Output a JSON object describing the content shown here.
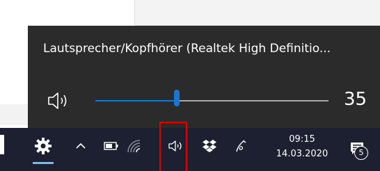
{
  "volume_flyout": {
    "device_name": "Lautsprecher/Kopfhörer (Realtek High Definitio...",
    "volume_value": "35",
    "volume_level": 0.35,
    "speaker_icon": "speaker-icon"
  },
  "taskbar": {
    "settings_icon": "gear-icon",
    "tray_overflow_icon": "chevron-up-icon",
    "battery_icon": "battery-icon",
    "network_icon": "wifi-icon",
    "volume_icon": "speaker-icon",
    "dropbox_icon": "dropbox-icon",
    "pen_icon": "pen-icon",
    "clock": {
      "time": "09:15",
      "date": "14.03.2020"
    },
    "notification_count": "5"
  },
  "colors": {
    "flyout_bg": "#2b2b2b",
    "taskbar_bg": "#1c2030",
    "accent": "#1976d2",
    "highlight": "#e00000"
  }
}
